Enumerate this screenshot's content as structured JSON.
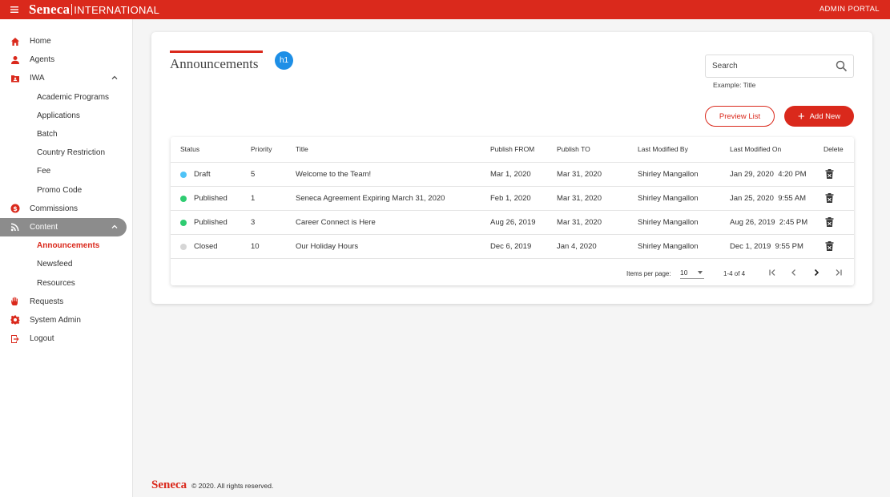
{
  "header": {
    "brand_name": "Seneca",
    "brand_sub": "INTERNATIONAL",
    "portal_label": "ADMIN PORTAL"
  },
  "sidebar": {
    "items": [
      {
        "label": "Home",
        "icon": "home-icon"
      },
      {
        "label": "Agents",
        "icon": "person-icon"
      },
      {
        "label": "IWA",
        "icon": "folder-account-icon",
        "expanded": true
      },
      {
        "label": "Academic Programs"
      },
      {
        "label": "Applications"
      },
      {
        "label": "Batch"
      },
      {
        "label": "Country Restriction"
      },
      {
        "label": "Fee"
      },
      {
        "label": "Promo Code"
      },
      {
        "label": "Commissions",
        "icon": "dollar-circle-icon"
      },
      {
        "label": "Content",
        "icon": "rss-icon",
        "expanded": true,
        "active": true
      },
      {
        "label": "Announcements",
        "current": true
      },
      {
        "label": "Newsfeed"
      },
      {
        "label": "Resources"
      },
      {
        "label": "Requests",
        "icon": "hand-icon"
      },
      {
        "label": "System Admin",
        "icon": "gear-icon"
      },
      {
        "label": "Logout",
        "icon": "logout-icon"
      }
    ]
  },
  "main": {
    "title": "Announcements",
    "badge": "h1",
    "search": {
      "placeholder": "Search",
      "hint": "Example: Title"
    },
    "preview_label": "Preview List",
    "add_label": "Add New"
  },
  "table": {
    "headers": [
      "Status",
      "Priority",
      "Title",
      "Publish FROM",
      "Publish TO",
      "Last Modified By",
      "Last Modified On",
      "Delete"
    ],
    "rows": [
      {
        "status": "Draft",
        "status_color": "#4fc3f7",
        "priority": "5",
        "title": "Welcome to the Team!",
        "from": "Mar 1, 2020",
        "to": "Mar 31, 2020",
        "by": "Shirley Mangallon",
        "on": "Jan 29, 2020  4:20 PM"
      },
      {
        "status": "Published",
        "status_color": "#2ecc71",
        "priority": "1",
        "title": "Seneca Agreement Expiring March 31, 2020",
        "from": "Feb 1, 2020",
        "to": "Mar 31, 2020",
        "by": "Shirley Mangallon",
        "on": "Jan 25, 2020  9:55 AM"
      },
      {
        "status": "Published",
        "status_color": "#2ecc71",
        "priority": "3",
        "title": "Career Connect is Here",
        "from": "Aug 26, 2019",
        "to": "Mar 31, 2020",
        "by": "Shirley Mangallon",
        "on": "Aug 26, 2019  2:45 PM"
      },
      {
        "status": "Closed",
        "status_color": "#d6d6d6",
        "priority": "10",
        "title": "Our Holiday Hours",
        "from": "Dec 6, 2019",
        "to": "Jan 4, 2020",
        "by": "Shirley Mangallon",
        "on": "Dec 1, 2019  9:55 PM"
      }
    ]
  },
  "pager": {
    "label": "Items per page:",
    "per_page": "10",
    "range": "1-4 of 4"
  },
  "footer": {
    "logo": "Seneca",
    "text": "© 2020. All rights reserved."
  },
  "colors": {
    "brand": "#da291c",
    "badge": "#1e8fe6",
    "active_nav": "#8c8c8c"
  }
}
